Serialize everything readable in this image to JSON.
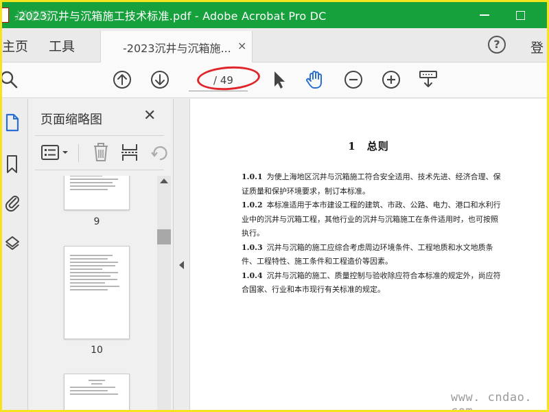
{
  "window": {
    "title": "-2023沉井与沉箱施工技术标准.pdf - Adobe Acrobat Pro DC",
    "watermark_corner": "道德网"
  },
  "menubar": {
    "home": "主页",
    "tools": "工具",
    "doc_tab_label": "-2023沉井与沉箱施...",
    "doc_tab_close": "×",
    "help": "?",
    "login": "登"
  },
  "toolbar": {
    "current_page": "",
    "total_pages": "/ 49"
  },
  "thumbnail_panel": {
    "title": "页面缩略图",
    "close": "✕",
    "pages": [
      {
        "label": "9"
      },
      {
        "label": "10"
      },
      {
        "label": ""
      }
    ]
  },
  "document": {
    "heading": "1　总则",
    "clauses": [
      {
        "num": "1.0.1",
        "text": "为使上海地区沉井与沉箱施工符合安全适用、技术先进、经济合理、保证质量和保护环境要求，制订本标准。"
      },
      {
        "num": "1.0.2",
        "text": "本标准适用于本市建设工程的建筑、市政、公路、电力、港口和水利行业中的沉井与沉箱工程，其他行业的沉井与沉箱施工在条件适用时，也可按照执行。"
      },
      {
        "num": "1.0.3",
        "text": "沉井与沉箱的施工应综合考虑周边环境条件、工程地质和水文地质条件、工程特性、施工条件和工程造价等因素。"
      },
      {
        "num": "1.0.4",
        "text": "沉井与沉箱的施工、质量控制与验收除应符合本标准的规定外，尚应符合国家、行业和本市现行有关标准的规定。"
      }
    ],
    "watermark": "www. cndao. com"
  },
  "colors": {
    "titlebar": "#16a13c",
    "outer_border": "#f6e31c",
    "annotation_circle": "#e0242a",
    "hand_tool_active": "#2a6ed4"
  }
}
